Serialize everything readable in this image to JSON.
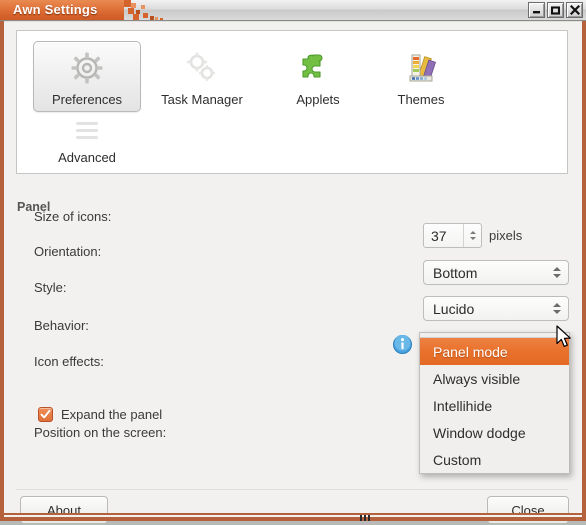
{
  "window": {
    "title": "Awn Settings",
    "controls": [
      {
        "name": "minimize-button",
        "glyph": "minimize"
      },
      {
        "name": "maximize-button",
        "glyph": "maximize"
      },
      {
        "name": "close-button",
        "glyph": "close"
      }
    ],
    "frame_color": "#b5623c",
    "title_tab_color": "#d4602a"
  },
  "toolbar": {
    "items": [
      {
        "label": "Preferences",
        "icon": "gear-icon",
        "selected": true
      },
      {
        "label": "Task Manager",
        "icon": "gears-icon",
        "selected": false
      },
      {
        "label": "Applets",
        "icon": "puzzle-piece-icon",
        "selected": false
      },
      {
        "label": "Themes",
        "icon": "palette-icon",
        "selected": false
      },
      {
        "label": "Advanced",
        "icon": "list-icon",
        "selected": false
      }
    ]
  },
  "panel": {
    "section_title": "Panel",
    "rows": {
      "size_label": "Size of icons:",
      "size_value": "37",
      "size_unit": "pixels",
      "orientation_label": "Orientation:",
      "orientation_value": "Bottom",
      "style_label": "Style:",
      "style_value": "Lucido",
      "behavior_label": "Behavior:",
      "icon_effects_label": "Icon effects:",
      "expand_label": "Expand the panel",
      "expand_checked": "checked",
      "position_label": "Position on the screen:"
    }
  },
  "behavior_menu": {
    "options": [
      {
        "label": "Panel mode",
        "selected": true
      },
      {
        "label": "Always visible",
        "selected": false
      },
      {
        "label": "Intellihide",
        "selected": false
      },
      {
        "label": "Window dodge",
        "selected": false
      },
      {
        "label": "Custom",
        "selected": false
      }
    ],
    "highlight_color": "#e8702a"
  },
  "footer": {
    "about_label": "About",
    "close_label": "Close"
  }
}
